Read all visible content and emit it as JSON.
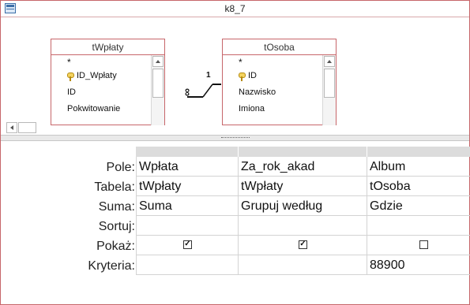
{
  "window": {
    "title": "k8_7"
  },
  "tables": [
    {
      "name": "tWpłaty",
      "fields": [
        "*",
        "ID_Wpłaty",
        "ID",
        "Pokwitowanie"
      ],
      "key_field": "ID_Wpłaty"
    },
    {
      "name": "tOsoba",
      "fields": [
        "*",
        "ID",
        "Nazwisko",
        "Imiona"
      ],
      "key_field": "ID"
    }
  ],
  "relationship": {
    "one_label": "1",
    "many_label": "∞"
  },
  "grid": {
    "row_labels": [
      "Pole:",
      "Tabela:",
      "Suma:",
      "Sortuj:",
      "Pokaż:",
      "Kryteria:"
    ],
    "columns": [
      {
        "pole": "Wpłata",
        "tabela": "tWpłaty",
        "suma": "Suma",
        "sortuj": "",
        "pokaz": true,
        "kryteria": ""
      },
      {
        "pole": "Za_rok_akad",
        "tabela": "tWpłaty",
        "suma": "Grupuj według",
        "sortuj": "",
        "pokaz": true,
        "kryteria": ""
      },
      {
        "pole": "Album",
        "tabela": "tOsoba",
        "suma": "Gdzie",
        "sortuj": "",
        "pokaz": false,
        "kryteria": "88900"
      }
    ]
  }
}
